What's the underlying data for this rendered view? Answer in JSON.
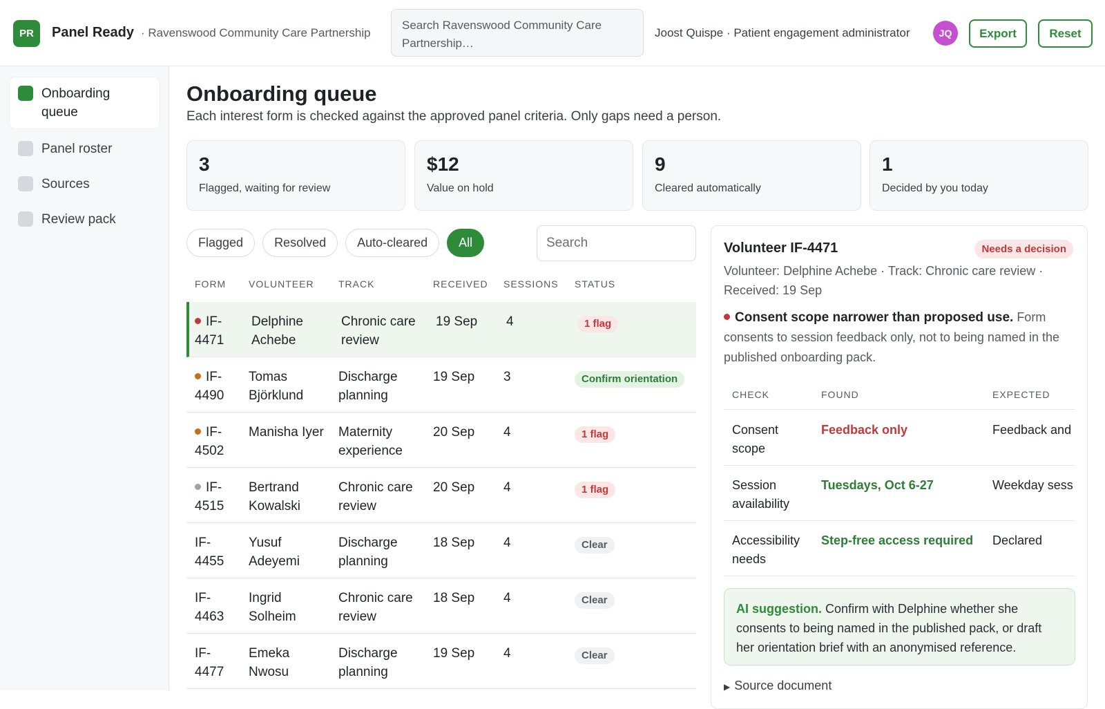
{
  "header": {
    "logo_initials": "PR",
    "app_name": "Panel Ready",
    "org_name": "· Ravenswood Community Care Partnership",
    "search_placeholder": "Search Ravenswood Community Care Partnership…",
    "user": "Joost Quispe · Patient engagement administrator",
    "avatar_initials": "JQ",
    "export_label": "Export",
    "reset_label": "Reset"
  },
  "sidebar": {
    "items": [
      {
        "label": "Onboarding queue",
        "active": true
      },
      {
        "label": "Panel roster",
        "active": false
      },
      {
        "label": "Sources",
        "active": false
      },
      {
        "label": "Review pack",
        "active": false
      }
    ]
  },
  "main": {
    "title": "Onboarding queue",
    "subtitle": "Each interest form is checked against the approved panel criteria. Only gaps need a person.",
    "stats": [
      {
        "value": "3",
        "label": "Flagged, waiting for review"
      },
      {
        "value": "$12",
        "label": "Value on hold"
      },
      {
        "value": "9",
        "label": "Cleared automatically"
      },
      {
        "value": "1",
        "label": "Decided by you today"
      }
    ],
    "filters": [
      "Flagged",
      "Resolved",
      "Auto-cleared",
      "All"
    ],
    "active_filter": "All",
    "search_placeholder": "Search",
    "columns": [
      "Form",
      "Volunteer",
      "Track",
      "Received",
      "Sessions",
      "Status"
    ],
    "rows": [
      {
        "form": "IF-4471",
        "volunteer": "Delphine Achebe",
        "track": "Chronic care review",
        "received": "19 Sep",
        "sessions": "4",
        "status": "1 flag",
        "status_kind": "flag",
        "dot": "#c0393b",
        "selected": true
      },
      {
        "form": "IF-4490",
        "volunteer": "Tomas Björklund",
        "track": "Discharge planning",
        "received": "19 Sep",
        "sessions": "3",
        "status": "Confirm orientation",
        "status_kind": "confirm",
        "dot": "#c2701f",
        "selected": false
      },
      {
        "form": "IF-4502",
        "volunteer": "Manisha Iyer",
        "track": "Maternity experience",
        "received": "20 Sep",
        "sessions": "4",
        "status": "1 flag",
        "status_kind": "flag",
        "dot": "#c2701f",
        "selected": false
      },
      {
        "form": "IF-4515",
        "volunteer": "Bertrand Kowalski",
        "track": "Chronic care review",
        "received": "20 Sep",
        "sessions": "4",
        "status": "1 flag",
        "status_kind": "flag",
        "dot": "#9ea3aa",
        "selected": false
      },
      {
        "form": "IF-4455",
        "volunteer": "Yusuf Adeyemi",
        "track": "Discharge planning",
        "received": "18 Sep",
        "sessions": "4",
        "status": "Clear",
        "status_kind": "clear",
        "dot": "",
        "selected": false
      },
      {
        "form": "IF-4463",
        "volunteer": "Ingrid Solheim",
        "track": "Chronic care review",
        "received": "18 Sep",
        "sessions": "4",
        "status": "Clear",
        "status_kind": "clear",
        "dot": "",
        "selected": false
      },
      {
        "form": "IF-4477",
        "volunteer": "Emeka Nwosu",
        "track": "Discharge planning",
        "received": "19 Sep",
        "sessions": "4",
        "status": "Clear",
        "status_kind": "clear",
        "dot": "",
        "selected": false
      }
    ]
  },
  "detail": {
    "title": "Volunteer IF-4471",
    "badge": "Needs a decision",
    "meta": "Volunteer: Delphine Achebe · Track: Chronic care review · Received: 19 Sep",
    "issue_title": "Consent scope narrower than proposed use.",
    "issue_text": "Form consents to session feedback only, not to being named in the published onboarding pack.",
    "columns": [
      "CHECK",
      "FOUND",
      "EXPECTED"
    ],
    "checks": [
      {
        "check": "Consent scope",
        "found": "Feedback only",
        "found_kind": "red",
        "expected": "Feedback and"
      },
      {
        "check": "Session availability",
        "found": "Tuesdays, Oct 6-27",
        "found_kind": "green",
        "expected": "Weekday sess"
      },
      {
        "check": "Accessibility needs",
        "found": "Step-free access required",
        "found_kind": "green",
        "expected": "Declared"
      }
    ],
    "ai_label": "AI suggestion.",
    "ai_text": "Confirm with Delphine whether she consents to being named in the published pack, or draft her orientation brief with an anonymised reference.",
    "source_label": "Source document"
  }
}
